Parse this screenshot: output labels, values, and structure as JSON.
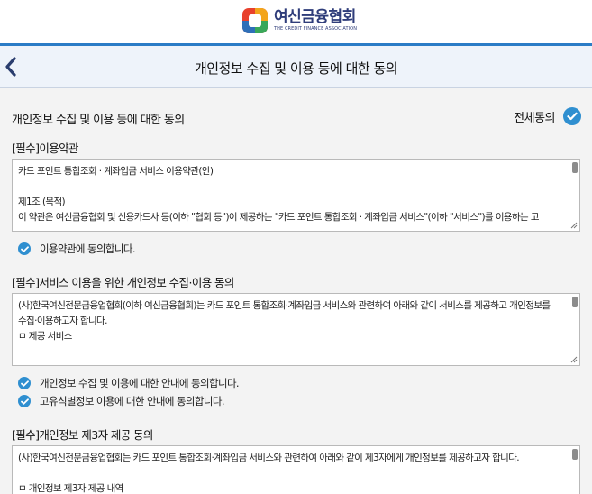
{
  "brand": {
    "name": "여신금융협회",
    "subtitle": "THE CREDIT FINANCE ASSOCIATION"
  },
  "header": {
    "title": "개인정보 수집 및 이용 등에 대한 동의",
    "back_icon": "chevron-left-icon"
  },
  "section": {
    "title": "개인정보 수집 및 이용 등에 대한 동의",
    "agree_all_label": "전체동의"
  },
  "terms": {
    "title": "[필수]이용약관",
    "content": "카드 포인트 통합조회 · 계좌입금 서비스 이용약관(안)\n\n제1조 (목적)\n이 약관은 여신금융협회 및 신용카드사 등(이하 \"협회 등\")이 제공하는 \"카드 포인트 통합조회 · 계좌입금 서비스\"(이하 \"서비스\")를 이용하는 고",
    "check_label": "이용약관에 동의합니다."
  },
  "privacy": {
    "title": "[필수]서비스 이용을 위한 개인정보 수집·이용 동의",
    "content": "(사)한국여신전문금융업협회(이하 여신금융협회)는 카드 포인트 통합조회·계좌입금 서비스와 관련하여 아래와 같이 서비스를 제공하고 개인정보를 수집·이용하고자 합니다.\nㅁ 제공 서비스",
    "check_label_1": "개인정보 수집 및 이용에 대한 안내에 동의합니다.",
    "check_label_2": "고유식별정보 이용에 대한 안내에 동의합니다."
  },
  "thirdparty": {
    "title": "[필수]개인정보 제3자 제공 동의",
    "content": "(사)한국여신전문금융업협회는 카드 포인트 통합조회·계좌입금 서비스와 관련하여 아래와 같이 제3자에게 개인정보를 제공하고자 합니다.\n\nㅁ 개인정보 제3자 제공 내역"
  },
  "colors": {
    "accent_blue": "#2b7cc6",
    "check_blue": "#2f8fd0",
    "brand_navy": "#2f3d7a"
  }
}
